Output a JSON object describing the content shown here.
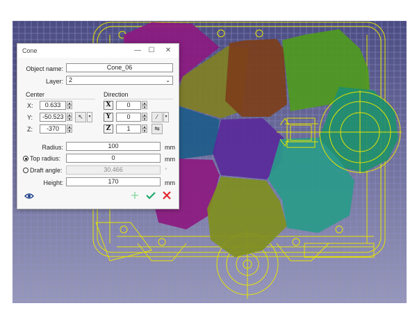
{
  "dialog": {
    "title": "Cone",
    "window_buttons": {
      "minimize": "—",
      "maximize": "☐",
      "close": "✕"
    },
    "object_name_label": "Object name:",
    "object_name_value": "Cone_06",
    "layer_label": "Layer:",
    "layer_value": "2",
    "center_label": "Center",
    "direction_label": "Direction",
    "x_label": "X:",
    "y_label": "Y:",
    "z_label": "Z:",
    "center_x": "0.633",
    "center_y": "-50.523",
    "center_z": "-370",
    "dir_x_icon": "X",
    "dir_y_icon": "Y",
    "dir_z_icon": "Z",
    "dir_x": "0",
    "dir_y": "0",
    "dir_z": "1",
    "radius_label": "Radius:",
    "radius_value": "100",
    "top_radius_label": "Top radius:",
    "top_radius_value": "0",
    "draft_angle_label": "Draft angle:",
    "draft_angle_value": "30.466",
    "height_label": "Height:",
    "height_value": "170",
    "unit_mm": "mm",
    "unit_deg": "°",
    "top_radius_selected": true,
    "draft_angle_selected": false
  },
  "icons": {
    "eye": "eye-icon",
    "plus": "plus-icon",
    "check": "check-icon",
    "cancel": "cancel-icon",
    "cursor": "cursor-pick-icon",
    "pick_direction": "pick-direction-icon",
    "reverse_direction": "reverse-direction-icon"
  },
  "colors": {
    "background_top": "#4b4c82",
    "background_bottom": "#9494b8",
    "wireframe": "#e8e400",
    "grid": "#8a8fc8",
    "accept": "#1ea86a",
    "cancel": "#e0262b",
    "plus": "#8fd8a8",
    "cone_magenta": "#8c1a80",
    "cone_olive": "#7f7f24",
    "cone_brown": "#7d3f1a",
    "cone_green": "#4f9a1e",
    "cone_teal": "#1e8f6e",
    "cone_purple": "#5a2a9a",
    "cone_blue": "#1e5c8a",
    "cone_cyan": "#2a9a8a",
    "cone_yellowgreen": "#7f8f1e"
  }
}
